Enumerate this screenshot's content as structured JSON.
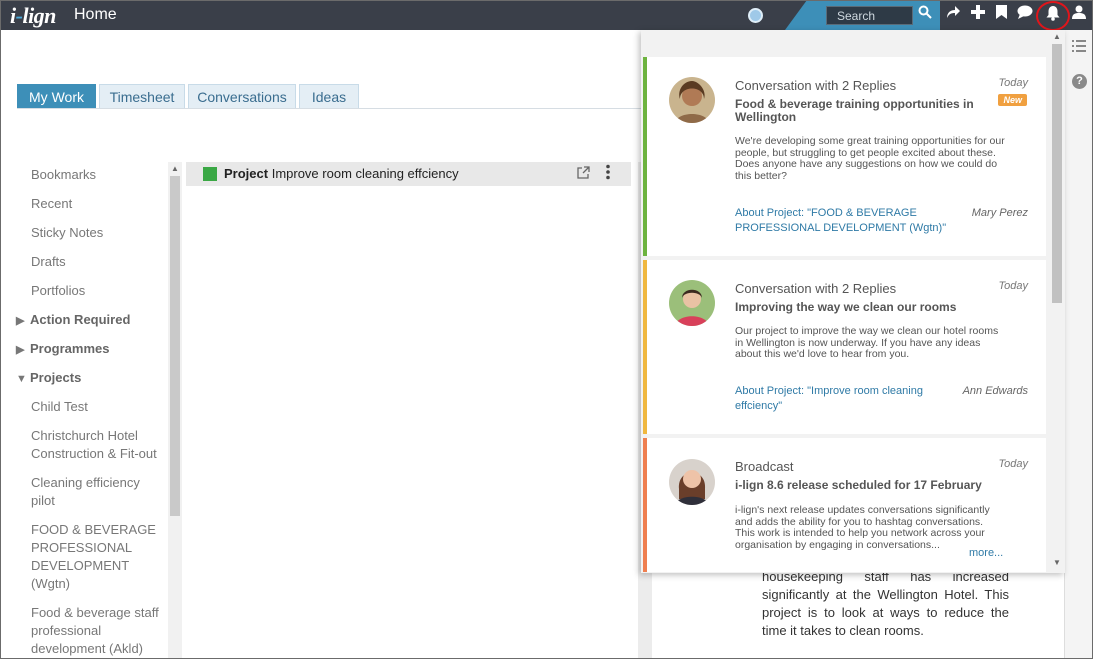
{
  "header": {
    "logo_text": "i-lign",
    "page_title": "Home",
    "search_placeholder": "Search",
    "icons": [
      "globe-icon",
      "search-icon",
      "share-icon",
      "plus-icon",
      "bookmark-icon",
      "chat-icon",
      "bell-icon",
      "user-icon"
    ],
    "accent_color": "#3d8fb8",
    "bar_color": "#3a3f49",
    "highlight_ring_color": "#e0151b"
  },
  "tabs": [
    {
      "label": "My Work",
      "active": true
    },
    {
      "label": "Timesheet",
      "active": false
    },
    {
      "label": "Conversations",
      "active": false
    },
    {
      "label": "Ideas",
      "active": false
    }
  ],
  "sidebar": {
    "items": [
      {
        "label": "Bookmarks"
      },
      {
        "label": "Recent"
      },
      {
        "label": "Sticky Notes"
      },
      {
        "label": "Drafts"
      },
      {
        "label": "Portfolios"
      }
    ],
    "sections": [
      {
        "label": "Action Required",
        "expanded": false
      },
      {
        "label": "Programmes",
        "expanded": false
      },
      {
        "label": "Projects",
        "expanded": true
      }
    ],
    "projects": [
      {
        "label": "Child Test"
      },
      {
        "label": "Christchurch Hotel Construction & Fit-out"
      },
      {
        "label": "Cleaning efficiency pilot"
      },
      {
        "label": "FOOD & BEVERAGE PROFESSIONAL DEVELOPMENT (Wgtn)"
      },
      {
        "label": "Food & beverage staff professional development (Akld)"
      }
    ]
  },
  "project": {
    "prefix": "Project",
    "name": "Improve room cleaning effciency",
    "status_color": "#3aa845"
  },
  "body_text": "housekeeping staff has increased significantly at the Wellington Hotel. This project is to look at ways to reduce the time it takes to clean rooms.",
  "notifications": [
    {
      "type": "Conversation with 2 Replies",
      "date": "Today",
      "badge": "New",
      "title": "Food & beverage training opportunities in Wellington",
      "body": "We're developing some great training opportunities for our people, but struggling to get people excited about these. Does anyone have any suggestions on how we could do this better?",
      "link": "About Project: \"FOOD & BEVERAGE PROFESSIONAL DEVELOPMENT (Wgtn)\"",
      "author": "Mary Perez",
      "accent": "#6db33f"
    },
    {
      "type": "Conversation with 2 Replies",
      "date": "Today",
      "title": "Improving the way we clean our rooms",
      "body": "Our project to improve the way we clean our hotel rooms in Wellington is now underway.  If you have any ideas about this we'd love to hear from you.",
      "link": "About Project: \"Improve room cleaning effciency\"",
      "author": "Ann Edwards",
      "accent": "#f0b840"
    },
    {
      "type": "Broadcast",
      "date": "Today",
      "title": "i-lign 8.6 release scheduled for 17 February",
      "body": "i-lign's next release updates conversations significantly and adds the ability for you to hashtag conversations. This work is intended to help you network across your organisation by engaging in conversations...",
      "more": "more...",
      "accent": "#ef7f50"
    }
  ]
}
